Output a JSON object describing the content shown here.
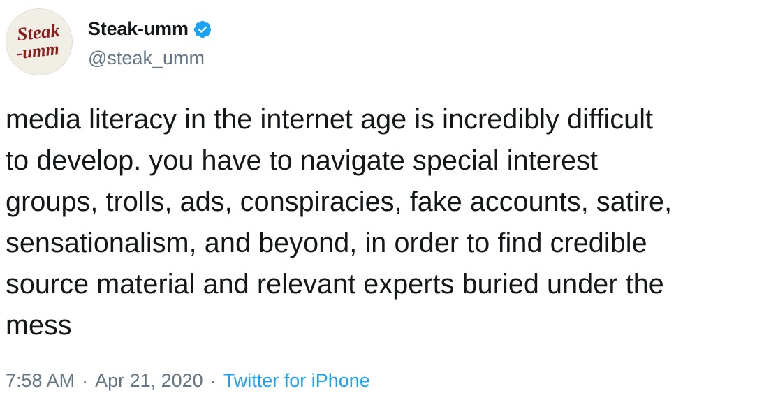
{
  "author": {
    "display_name": "Steak-umm",
    "handle": "@steak_umm",
    "verified": true,
    "avatar_logo_text": [
      "Steak",
      "-umm"
    ],
    "avatar_logo_color": "#8b1d1d"
  },
  "tweet": {
    "text": "media literacy in the internet age is incredibly difficult\nto develop. you have to navigate special interest\ngroups, trolls, ads, conspiracies, fake accounts, satire,\nsensationalism, and beyond, in order to find credible\nsource material and relevant experts buried under the\nmess"
  },
  "meta": {
    "time": "7:58 AM",
    "separator": "·",
    "date": "Apr 21, 2020",
    "source": "Twitter for iPhone"
  },
  "colors": {
    "text": "#14171a",
    "secondary": "#657786",
    "link": "#1da1f2",
    "verified_badge": "#1da1f2"
  }
}
